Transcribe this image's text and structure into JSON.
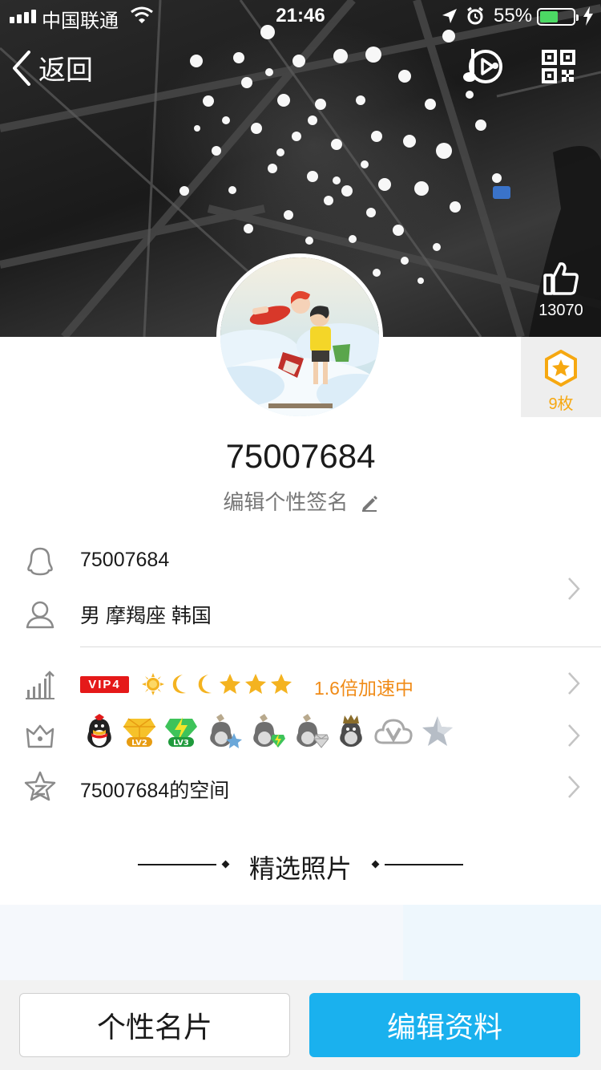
{
  "status_bar": {
    "carrier": "中国联通",
    "time": "21:46",
    "battery_percent": "55%",
    "battery_level": 0.55,
    "battery_color": "#4cd964"
  },
  "nav": {
    "back_label": "返回",
    "music_icon": "music-play-icon",
    "qr_icon": "qr-code-icon"
  },
  "profile": {
    "likes_count": "13070",
    "badges_count": "9枚",
    "nickname": "75007684",
    "signature_placeholder": "编辑个性签名"
  },
  "info": {
    "qq_number": "75007684",
    "gender_constellation_location": "男 摩羯座 韩国",
    "vip_label": "VIP4",
    "speed_text": "1.6倍加速中",
    "speed_color": "#f08b17",
    "qzone_label": "75007684的空间"
  },
  "level_icons": [
    "sun-icon",
    "moon-icon",
    "moon-icon",
    "star-icon",
    "star-icon",
    "star-icon"
  ],
  "service_icons": [
    "qq-penguin-icon",
    "diamond-lv2-icon",
    "lightning-lv3-icon",
    "penguin-star-icon",
    "penguin-lightning-icon",
    "penguin-diamond-icon",
    "penguin-crown-icon",
    "cloud-v-icon",
    "gray-star-icon"
  ],
  "service_level_labels": [
    "LV2",
    "LV3"
  ],
  "section": {
    "title": "精选照片"
  },
  "buttons": {
    "card_label": "个性名片",
    "edit_label": "编辑资料"
  },
  "colors": {
    "accent_blue": "#1ab1ee",
    "badge_gold": "#f6a811",
    "vip_red": "#e51919"
  }
}
